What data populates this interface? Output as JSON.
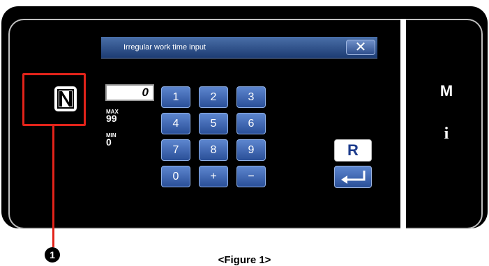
{
  "dialog": {
    "title": "Irregular work time input",
    "close_label": "✕"
  },
  "input": {
    "value": "0"
  },
  "limits": {
    "max_label": "MAX",
    "max_value": "99",
    "min_label": "MIN",
    "min_value": "0"
  },
  "keypad": [
    "1",
    "2",
    "3",
    "4",
    "5",
    "6",
    "7",
    "8",
    "9",
    "0",
    "+",
    "−"
  ],
  "reset_key": {
    "label": "R"
  },
  "enter_key": {
    "icon": "enter-arrow-icon"
  },
  "side_panel": {
    "mode_label": "M",
    "info_label": "i"
  },
  "nfc": {
    "icon": "nfc-icon"
  },
  "callout": {
    "number": "1"
  },
  "caption": "<Figure 1>",
  "colors": {
    "accent": "#e2231a",
    "button": "#3a64b0"
  }
}
